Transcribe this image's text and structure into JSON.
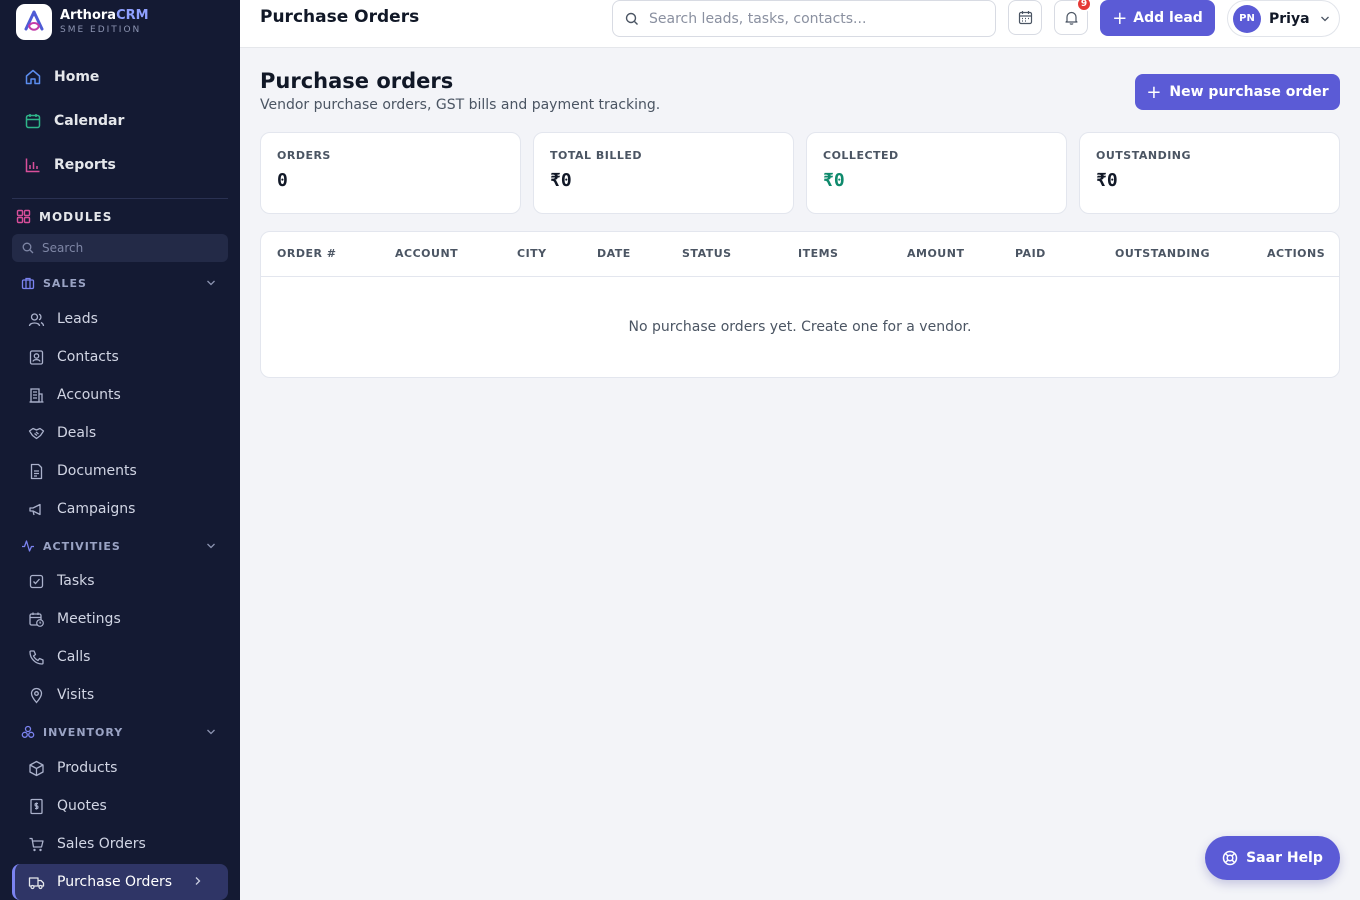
{
  "brand": {
    "name_main": "Arthora",
    "name_accent": "CRM",
    "edition": "SME EDITION"
  },
  "sidebar": {
    "top_items": [
      {
        "label": "Home",
        "icon": "home-icon"
      },
      {
        "label": "Calendar",
        "icon": "calendar-icon"
      },
      {
        "label": "Reports",
        "icon": "bar-chart-icon"
      }
    ],
    "modules_label": "MODULES",
    "search_placeholder": "Search",
    "sections": [
      {
        "label": "SALES",
        "icon": "briefcase-icon",
        "items": [
          "Leads",
          "Contacts",
          "Accounts",
          "Deals",
          "Documents",
          "Campaigns"
        ]
      },
      {
        "label": "ACTIVITIES",
        "icon": "activity-icon",
        "items": [
          "Tasks",
          "Meetings",
          "Calls",
          "Visits"
        ]
      },
      {
        "label": "INVENTORY",
        "icon": "boxes-icon",
        "items": [
          "Products",
          "Quotes",
          "Sales Orders",
          "Purchase Orders"
        ]
      }
    ],
    "active_item": "Purchase Orders"
  },
  "header": {
    "title": "Purchase Orders",
    "search_placeholder": "Search leads, tasks, contacts...",
    "notification_count": "9",
    "add_lead_label": "Add lead",
    "user_initials": "PN",
    "user_name": "Priya"
  },
  "main": {
    "title": "Purchase orders",
    "subtitle": "Vendor purchase orders, GST bills and payment tracking.",
    "new_button_label": "New purchase order",
    "stats": [
      {
        "label": "ORDERS",
        "value": "0"
      },
      {
        "label": "TOTAL BILLED",
        "value": "₹0"
      },
      {
        "label": "COLLECTED",
        "value": "₹0"
      },
      {
        "label": "OUTSTANDING",
        "value": "₹0"
      }
    ],
    "table": {
      "columns": [
        "ORDER #",
        "ACCOUNT",
        "CITY",
        "DATE",
        "STATUS",
        "ITEMS",
        "AMOUNT",
        "PAID",
        "OUTSTANDING",
        "ACTIONS"
      ],
      "empty_message": "No purchase orders yet. Create one for a vendor."
    }
  },
  "help_button_label": "Saar Help",
  "colors": {
    "accent": "#5b5bd6",
    "sidebar_bg": "#141a33",
    "collected_green": "#0f8a6c",
    "badge_red": "#e53935"
  }
}
